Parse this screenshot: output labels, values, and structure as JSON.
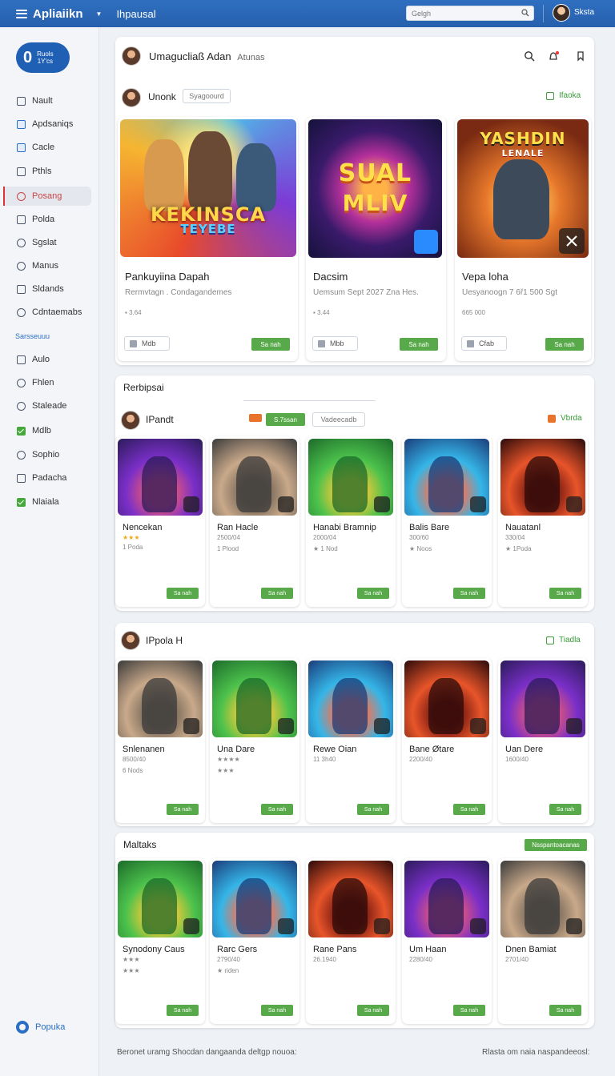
{
  "topbar": {
    "app_title": "Apliaiikn",
    "page_tab": "Ihpausal",
    "search_placeholder": "Gelgh",
    "user_name": "Sksta"
  },
  "sidebar": {
    "brand_letter": "0",
    "brand_text_1": "Ruols",
    "brand_text_2": "1Y'cs",
    "items": [
      {
        "label": "Nault",
        "icon": "home-icon"
      },
      {
        "label": "Apdsaniqs",
        "icon": "chart-icon"
      },
      {
        "label": "Cacle",
        "icon": "tablet-icon"
      },
      {
        "label": "Pthls",
        "icon": "bookmark-icon"
      },
      {
        "label": "Posang",
        "icon": "gamepad-icon"
      },
      {
        "label": "Polda",
        "icon": "box-icon"
      },
      {
        "label": "Sgslat",
        "icon": "gear-icon"
      },
      {
        "label": "Manus",
        "icon": "people-icon"
      },
      {
        "label": "Sldands",
        "icon": "list-icon"
      },
      {
        "label": "Cdntaemabs",
        "icon": "circle-icon"
      }
    ],
    "section_label": "Sarsseuuu",
    "items2": [
      {
        "label": "Aulo",
        "icon": "folder-icon"
      },
      {
        "label": "Fhlen",
        "icon": "tag-icon"
      },
      {
        "label": "Staleade",
        "icon": "circle-icon"
      },
      {
        "label": "Mdlb",
        "icon": "check-icon"
      },
      {
        "label": "Sophio",
        "icon": "cloud-icon"
      },
      {
        "label": "Padacha",
        "icon": "file-icon"
      },
      {
        "label": "Nlaiala",
        "icon": "check-icon"
      }
    ],
    "help_label": "Popuka"
  },
  "featured": {
    "header_title": "Umagucliaß Adan",
    "header_sub": "Atunas",
    "row_title": "Unonk",
    "filter_chip": "Syagoourd",
    "see_all": "Ifaoka",
    "cards": [
      {
        "title": "Pankuyiina Dapah",
        "desc": "Rermvtagn . Condagandemes",
        "meta": "3.64",
        "btn_secondary": "Mdb",
        "btn_primary": "Sa nah",
        "logo_1": "KEKINSCA",
        "logo_2": "TEYEBE"
      },
      {
        "title": "Dacsim",
        "desc": "Uemsum Sept 2027 Zna Hes.",
        "meta": "3.44",
        "btn_secondary": "Mbb",
        "btn_primary": "Sa nah",
        "logo_1": "SUAL",
        "logo_2": "MLIV"
      },
      {
        "title": "Vepa loha",
        "desc": "Uesyanoogn 7 6ř1 500 Sgt",
        "meta": "665 000",
        "btn_secondary": "Cfab",
        "btn_primary": "Sa nah",
        "logo_1": "YASHDIN",
        "logo_2": "LENALE"
      }
    ]
  },
  "section2": {
    "title": "Rerbipsai",
    "row_title": "IPandt",
    "tag_green": "S.7ssan",
    "filter_chip": "Vadeecadb",
    "see_all": "Vbrda",
    "cards": [
      {
        "title": "Nencekan",
        "rating": "★★★",
        "sub": "1 Poda",
        "btn": "Sa nah"
      },
      {
        "title": "Ran Hacle",
        "rating": "",
        "sub": "2500/04",
        "sub2": "1 Plood",
        "btn": "Sa nah"
      },
      {
        "title": "Hanabi Bramnip",
        "rating": "",
        "sub": "2000/04",
        "sub2": "★ 1 Nod",
        "btn": "Sa nah"
      },
      {
        "title": "Balis Bare",
        "rating": "",
        "sub": "300/60",
        "sub2": "★ Noos",
        "btn": "Sa nah"
      },
      {
        "title": "Nauatanl",
        "rating": "",
        "sub": "330/04",
        "sub2": "★ 1Poda",
        "btn": "Sa nah"
      }
    ]
  },
  "section3": {
    "row_title": "IPpola H",
    "see_all": "Tiadla",
    "cards": [
      {
        "title": "Snlenanen",
        "sub": "8500/40",
        "sub2": "6 Nods",
        "btn": "Sa nah"
      },
      {
        "title": "Una Dare",
        "sub": "★★★★",
        "sub2": "★★★",
        "btn": "Sa nah"
      },
      {
        "title": "Rewe Oian",
        "sub": "11 3h40",
        "sub2": "",
        "btn": "Sa nah"
      },
      {
        "title": "Bane Øtare",
        "sub": "2200/40",
        "sub2": "",
        "btn": "Sa nah"
      },
      {
        "title": "Uan Dere",
        "sub": "1600/40",
        "sub2": "",
        "btn": "Sa nah"
      }
    ]
  },
  "section4": {
    "title": "Maltaks",
    "tag_green": "Nsspantoacanas",
    "cards": [
      {
        "title": "Synodony Caus",
        "sub": "★★★",
        "sub2": "★★★",
        "btn": "Sa nah"
      },
      {
        "title": "Rarc Gers",
        "sub": "2790/40",
        "sub2": "★ riden",
        "btn": "Sa nah"
      },
      {
        "title": "Rane Pans",
        "sub": "26.1940",
        "sub2": "",
        "btn": "Sa nah"
      },
      {
        "title": "Um Haan",
        "sub": "2280/40",
        "sub2": "",
        "btn": "Sa nah"
      },
      {
        "title": "Dnen Bamiat",
        "sub": "2701/40",
        "sub2": "",
        "btn": "Sa nah"
      }
    ]
  },
  "footer": {
    "left": "Beronet uramg  Shocdan  dangaanda deltgp nouoa:",
    "right": "Rlasta  om  naia  naspandeeosl:"
  },
  "colors": {
    "topbar": "#2660ad",
    "accent_green": "#58a94a",
    "accent_blue": "#2a6fc5"
  }
}
